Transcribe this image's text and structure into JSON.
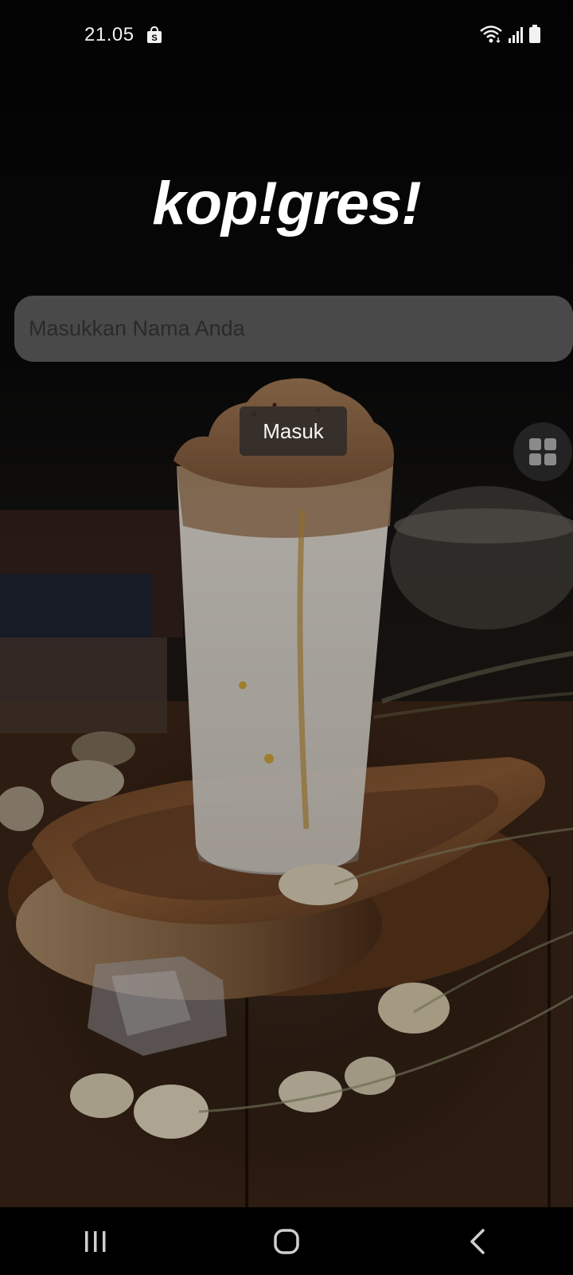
{
  "status_bar": {
    "time": "21.05",
    "icons": [
      "shopping-bag-icon",
      "wifi-icon",
      "signal-icon",
      "battery-icon"
    ]
  },
  "app": {
    "logo": "kop!gres!"
  },
  "login_form": {
    "name_placeholder": "Masukkan Nama Anda",
    "name_value": "",
    "submit_label": "Masuk"
  },
  "floating_button": {
    "icon": "grid-icon"
  },
  "nav_bar": {
    "items": [
      "recent-apps-icon",
      "home-icon",
      "back-icon"
    ]
  },
  "colors": {
    "logo": "#ffffff",
    "input_bg": "#5c5c5c",
    "button_bg": "#2d2a28"
  }
}
